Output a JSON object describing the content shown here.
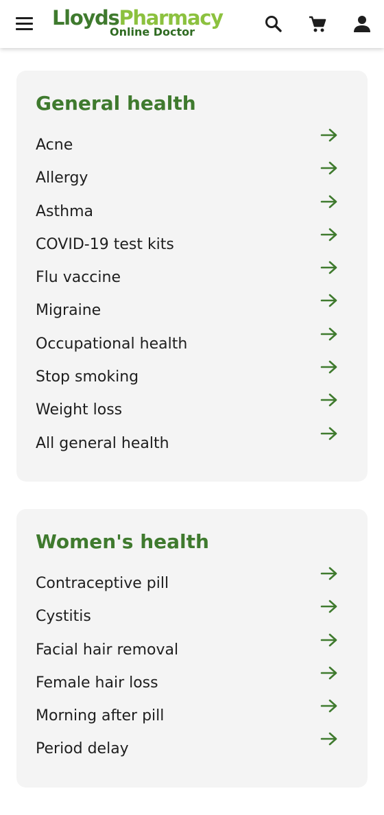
{
  "header": {
    "logo": {
      "brand_part1": "Lloyds",
      "brand_part2": "Pharmacy",
      "subtitle": "Online Doctor"
    },
    "icons": {
      "menu": "hamburger-menu-icon",
      "search": "search-icon",
      "cart": "shopping-cart-icon",
      "account": "account-icon"
    }
  },
  "sections": [
    {
      "title": "General health",
      "items": [
        "Acne",
        "Allergy",
        "Asthma",
        "COVID-19 test kits",
        "Flu vaccine",
        "Migraine",
        "Occupational health",
        "Stop smoking",
        "Weight loss",
        "All general health"
      ]
    },
    {
      "title": "Women's health",
      "items": [
        "Contraceptive pill",
        "Cystitis",
        "Facial hair removal",
        "Female hair loss",
        "Morning after pill",
        "Period delay"
      ]
    }
  ],
  "colors": {
    "brand_dark_green": "#3f7a2e",
    "brand_light_green": "#8cc13f",
    "card_background": "#f4f4f4",
    "text": "#1e1e1e",
    "arrow": "#3f7a2e"
  }
}
